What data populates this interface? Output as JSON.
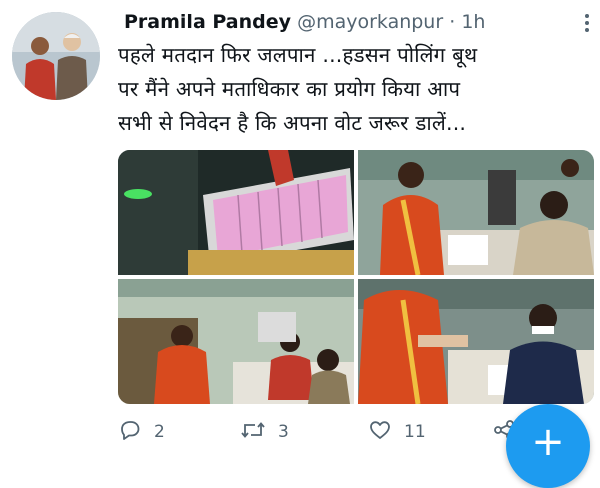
{
  "tweet": {
    "author_name": "Pramila Pandey",
    "handle": "@mayorkanpur",
    "separator": "·",
    "time": "1h",
    "text_lines": [
      "पहले मतदान फिर जलपान ...हडसन पोलिंग बूथ",
      "पर मैंने अपने मताधिकार का प्रयोग किया आप",
      "सभी से निवेदन है कि अपना वोट जरूर डालें..."
    ]
  },
  "actions": {
    "replies": "2",
    "retweets": "3",
    "likes": "11"
  },
  "fab": {
    "label": "+"
  },
  "colors": {
    "accent": "#1d9bf0",
    "text": "#0f1419",
    "muted": "#536471",
    "saree": "#d84a1e",
    "evm_pink": "#e8a6d6"
  },
  "icons": [
    "more-icon",
    "reply-icon",
    "retweet-icon",
    "like-icon",
    "share-icon",
    "plus-icon"
  ]
}
